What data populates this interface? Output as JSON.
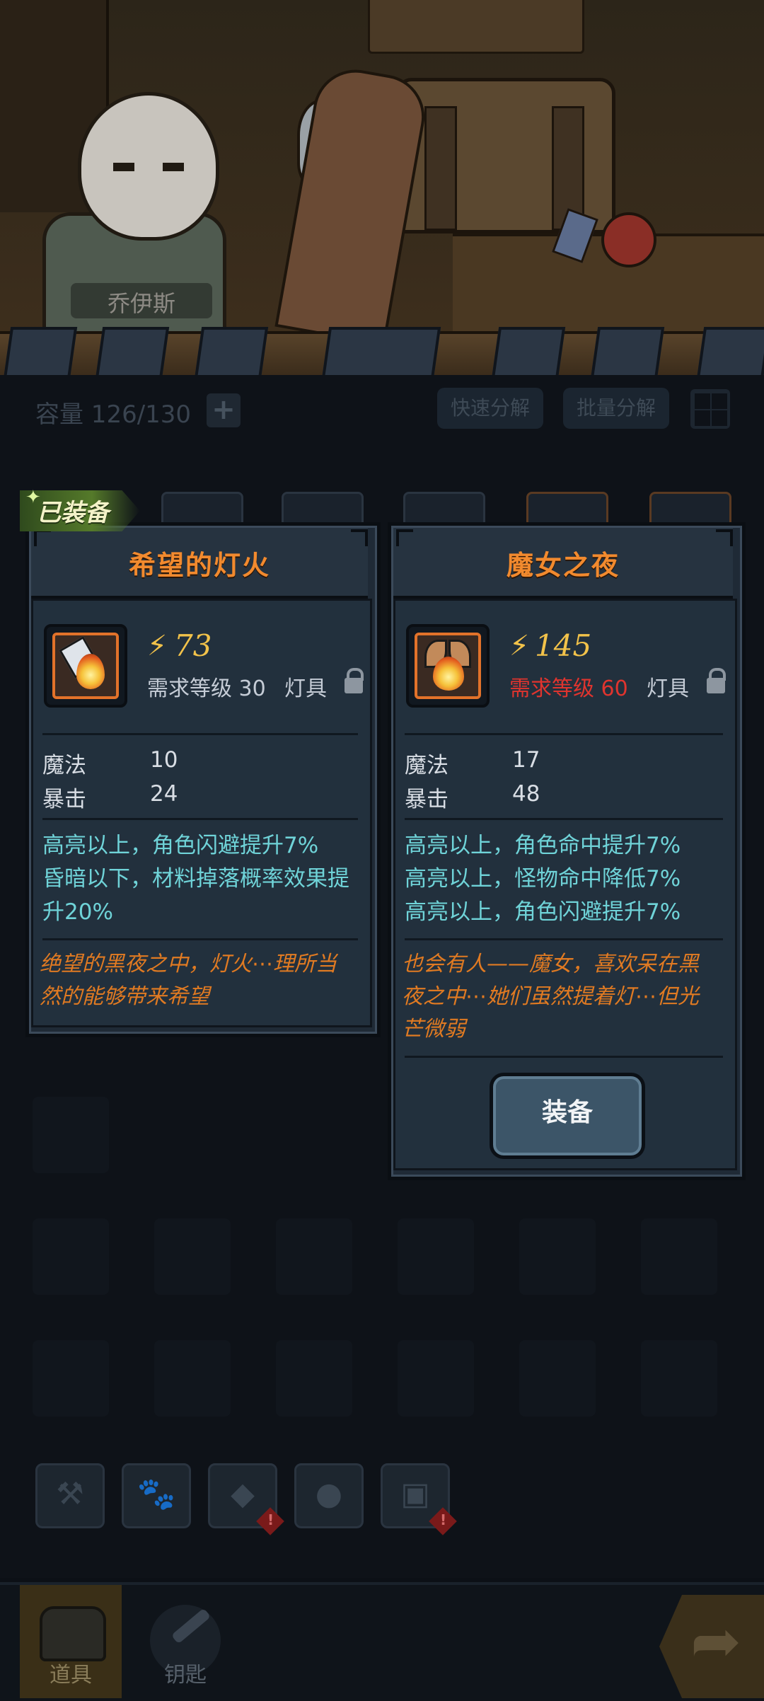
{
  "character": {
    "name": "乔伊斯"
  },
  "inventory": {
    "capacity_label": "容量 126/130",
    "add_icon": "plus-icon",
    "quick_dismantle": "快速分解",
    "batch_dismantle": "批量分解",
    "grid_icon": "grid-icon"
  },
  "equipped_badge": "已装备",
  "cards": [
    {
      "title": "希望的灯火",
      "power": "73",
      "requirement": "需求等级 30",
      "requirement_met": true,
      "type": "灯具",
      "stats": [
        {
          "name": "魔法",
          "value": "10"
        },
        {
          "name": "暴击",
          "value": "24"
        }
      ],
      "effects": [
        "高亮以上，角色闪避提升7%",
        "昏暗以下，材料掉落概率效果提",
        "升20%"
      ],
      "flavor": [
        "绝望的黑夜之中，灯火⋯理所当",
        "然的能够带来希望"
      ]
    },
    {
      "title": "魔女之夜",
      "power": "145",
      "requirement": "需求等级 60",
      "requirement_met": false,
      "type": "灯具",
      "stats": [
        {
          "name": "魔法",
          "value": "17"
        },
        {
          "name": "暴击",
          "value": "48"
        }
      ],
      "effects": [
        "高亮以上，角色命中提升7%",
        "高亮以上，怪物命中降低7%",
        "高亮以上，角色闪避提升7%"
      ],
      "flavor": [
        "也会有人——魔女，喜欢呆在黑",
        "夜之中⋯她们虽然提着灯⋯但光",
        "芒微弱"
      ],
      "action": "装备"
    }
  ],
  "colors": {
    "title_orange": "#f28a2e",
    "effect_cyan": "#6fd3d8",
    "flavor_orange": "#e07a22",
    "requirement_red": "#e0342e",
    "power_gold": "#f2c24a"
  },
  "bottom_nav": {
    "items_label": "道具",
    "keys_label": "钥匙"
  }
}
